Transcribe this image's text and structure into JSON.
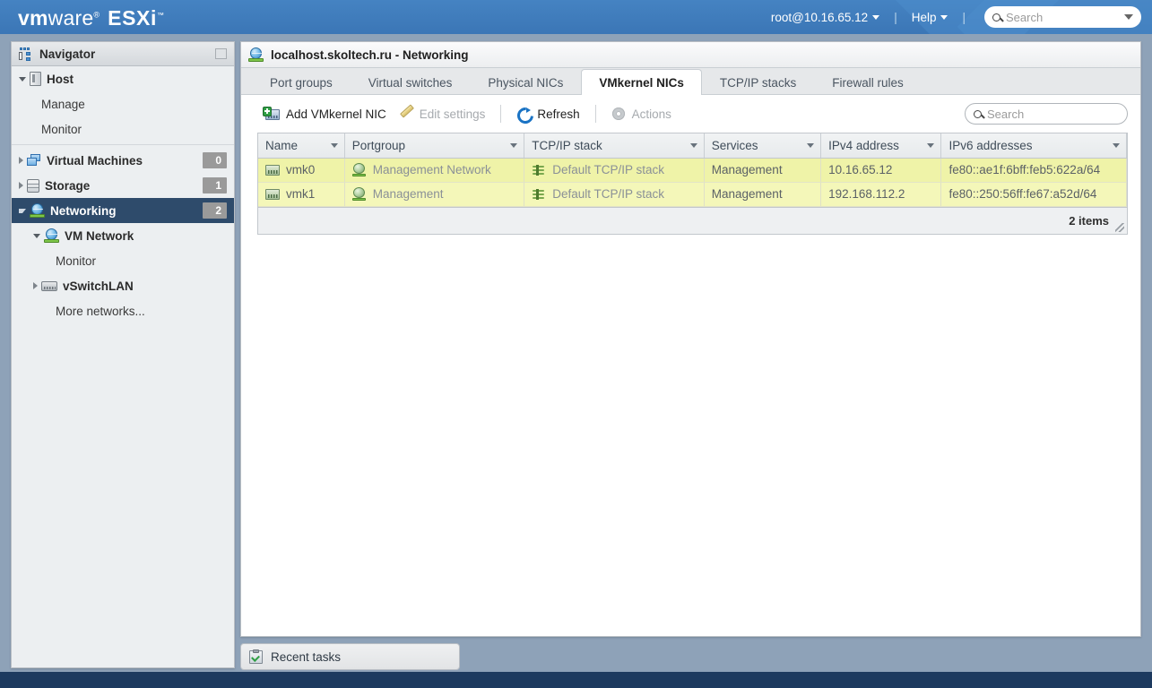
{
  "topbar": {
    "brand_vm": "vm",
    "brand_ware": "ware",
    "brand_reg": "®",
    "brand_esxi": "ESXi",
    "brand_tm": "™",
    "user": "root@10.16.65.12",
    "help": "Help",
    "search_placeholder": "Search",
    "accent_color": "#3e7bbb"
  },
  "navigator": {
    "title": "Navigator",
    "restore_icon": "restore-window-icon",
    "items": [
      {
        "label": "Host",
        "icon": "host-icon",
        "expander": "down",
        "bold": true,
        "indent": 0,
        "badge": null
      },
      {
        "label": "Manage",
        "icon": "none",
        "expander": "none",
        "bold": false,
        "indent": 1,
        "badge": null
      },
      {
        "label": "Monitor",
        "icon": "none",
        "expander": "none",
        "bold": false,
        "indent": 1,
        "badge": null
      },
      {
        "label": "Virtual Machines",
        "icon": "vm-icon",
        "expander": "right",
        "bold": true,
        "indent": 0,
        "badge": "0"
      },
      {
        "label": "Storage",
        "icon": "storage-icon",
        "expander": "right",
        "bold": true,
        "indent": 0,
        "badge": "1"
      },
      {
        "label": "Networking",
        "icon": "network-icon",
        "expander": "down",
        "bold": true,
        "indent": 0,
        "badge": "2",
        "selected": true
      },
      {
        "label": "VM Network",
        "icon": "network-icon",
        "expander": "down",
        "bold": true,
        "indent": 1,
        "badge": null
      },
      {
        "label": "Monitor",
        "icon": "none",
        "expander": "none",
        "bold": false,
        "indent": 2,
        "badge": null
      },
      {
        "label": "vSwitchLAN",
        "icon": "switch-icon",
        "expander": "right",
        "bold": true,
        "indent": 1,
        "badge": null
      },
      {
        "label": "More networks...",
        "icon": "none",
        "expander": "none",
        "bold": false,
        "indent": 2,
        "badge": null
      }
    ]
  },
  "content": {
    "header_title": "localhost.skoltech.ru - Networking",
    "tabs": [
      {
        "label": "Port groups",
        "active": false
      },
      {
        "label": "Virtual switches",
        "active": false
      },
      {
        "label": "Physical NICs",
        "active": false
      },
      {
        "label": "VMkernel NICs",
        "active": true
      },
      {
        "label": "TCP/IP stacks",
        "active": false
      },
      {
        "label": "Firewall rules",
        "active": false
      }
    ],
    "toolbar": {
      "add_label": "Add VMkernel NIC",
      "edit_label": "Edit settings",
      "edit_disabled": true,
      "refresh_label": "Refresh",
      "actions_label": "Actions",
      "actions_disabled": true,
      "search_placeholder": "Search"
    },
    "table": {
      "columns": [
        "Name",
        "Portgroup",
        "TCP/IP stack",
        "Services",
        "IPv4 address",
        "IPv6 addresses"
      ],
      "rows": [
        {
          "name": "vmk0",
          "portgroup": "Management Network",
          "tcpip_stack": "Default TCP/IP stack",
          "services": "Management",
          "ipv4": "10.16.65.12",
          "ipv6": "fe80::ae1f:6bff:feb5:622a/64"
        },
        {
          "name": "vmk1",
          "portgroup": "Management",
          "tcpip_stack": "Default TCP/IP stack",
          "services": "Management",
          "ipv4": "192.168.112.2",
          "ipv6": "fe80::250:56ff:fe67:a52d/64"
        }
      ],
      "footer_count": "2 items",
      "row_highlight_color": "#eff3a8"
    }
  },
  "recent_tasks": {
    "label": "Recent tasks",
    "icon": "tasks-clipboard-icon"
  }
}
